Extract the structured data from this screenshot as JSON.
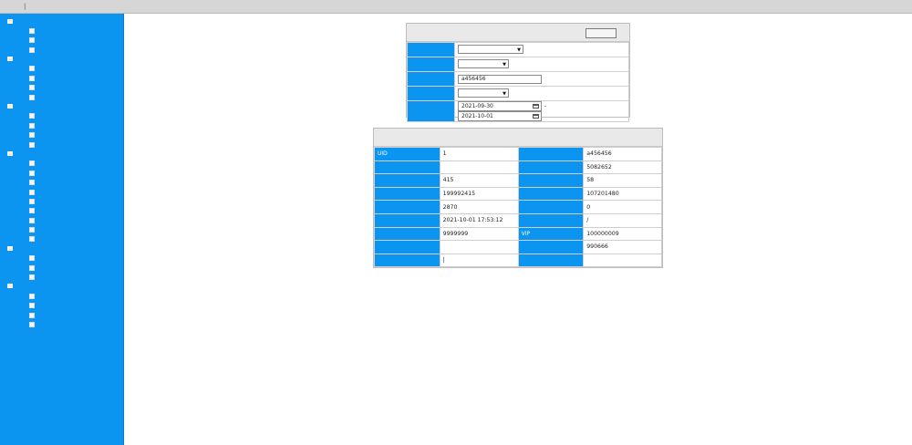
{
  "topbar": {
    "greeting": "",
    "links": [
      "",
      ""
    ],
    "logout": ""
  },
  "sidebar": {
    "groups": [
      {
        "title": "",
        "items": [
          "",
          "",
          ""
        ]
      },
      {
        "title": "",
        "items": [
          "",
          "",
          "",
          ""
        ]
      },
      {
        "title": "",
        "items": [
          "",
          "",
          "",
          ""
        ]
      },
      {
        "title": "",
        "items": [
          "",
          "",
          "",
          "",
          "",
          "",
          "",
          "",
          ""
        ]
      },
      {
        "title": "",
        "items": [
          "",
          "",
          ""
        ]
      },
      {
        "title": "",
        "items": [
          "",
          "",
          "",
          ""
        ]
      }
    ]
  },
  "query": {
    "title": "",
    "button": "",
    "rows": [
      {
        "label": "",
        "type": "select",
        "value": ""
      },
      {
        "label": "",
        "type": "select",
        "value": ""
      },
      {
        "label": "",
        "type": "input",
        "value": "a456456"
      },
      {
        "label": "",
        "type": "select",
        "value": ""
      },
      {
        "label": "",
        "type": "daterange",
        "start": "2021-09-30",
        "end": "2021-10-01"
      }
    ]
  },
  "basic": {
    "title": "",
    "rows": [
      [
        {
          "label": "UID",
          "value": "1"
        },
        {
          "label": "",
          "value": "a456456"
        }
      ],
      [
        {
          "label": "",
          "value": ""
        },
        {
          "label": "",
          "value": "5082652"
        }
      ],
      [
        {
          "label": "",
          "value": "415"
        },
        {
          "label": "",
          "value": "58"
        }
      ],
      [
        {
          "label": "",
          "value": "199992415"
        },
        {
          "label": "",
          "value": "107201480"
        }
      ],
      [
        {
          "label": "",
          "value": "2870"
        },
        {
          "label": "",
          "value": "0"
        }
      ],
      [
        {
          "label": "",
          "value": "2021-10-01 17:53:12"
        },
        {
          "label": "",
          "value": "/"
        }
      ],
      [
        {
          "label": "",
          "value": "9999999"
        },
        {
          "label": "VIP",
          "value": "100000009"
        }
      ],
      [
        {
          "label": "",
          "value": ""
        },
        {
          "label": "",
          "value": "990666"
        }
      ]
    ],
    "status": {
      "label": "",
      "link_edit": "",
      "link_kick": ""
    }
  },
  "colors": {
    "accent": "#0b95f0",
    "topbar": "#d6d6d6",
    "panel_header": "#e9e9e9"
  }
}
